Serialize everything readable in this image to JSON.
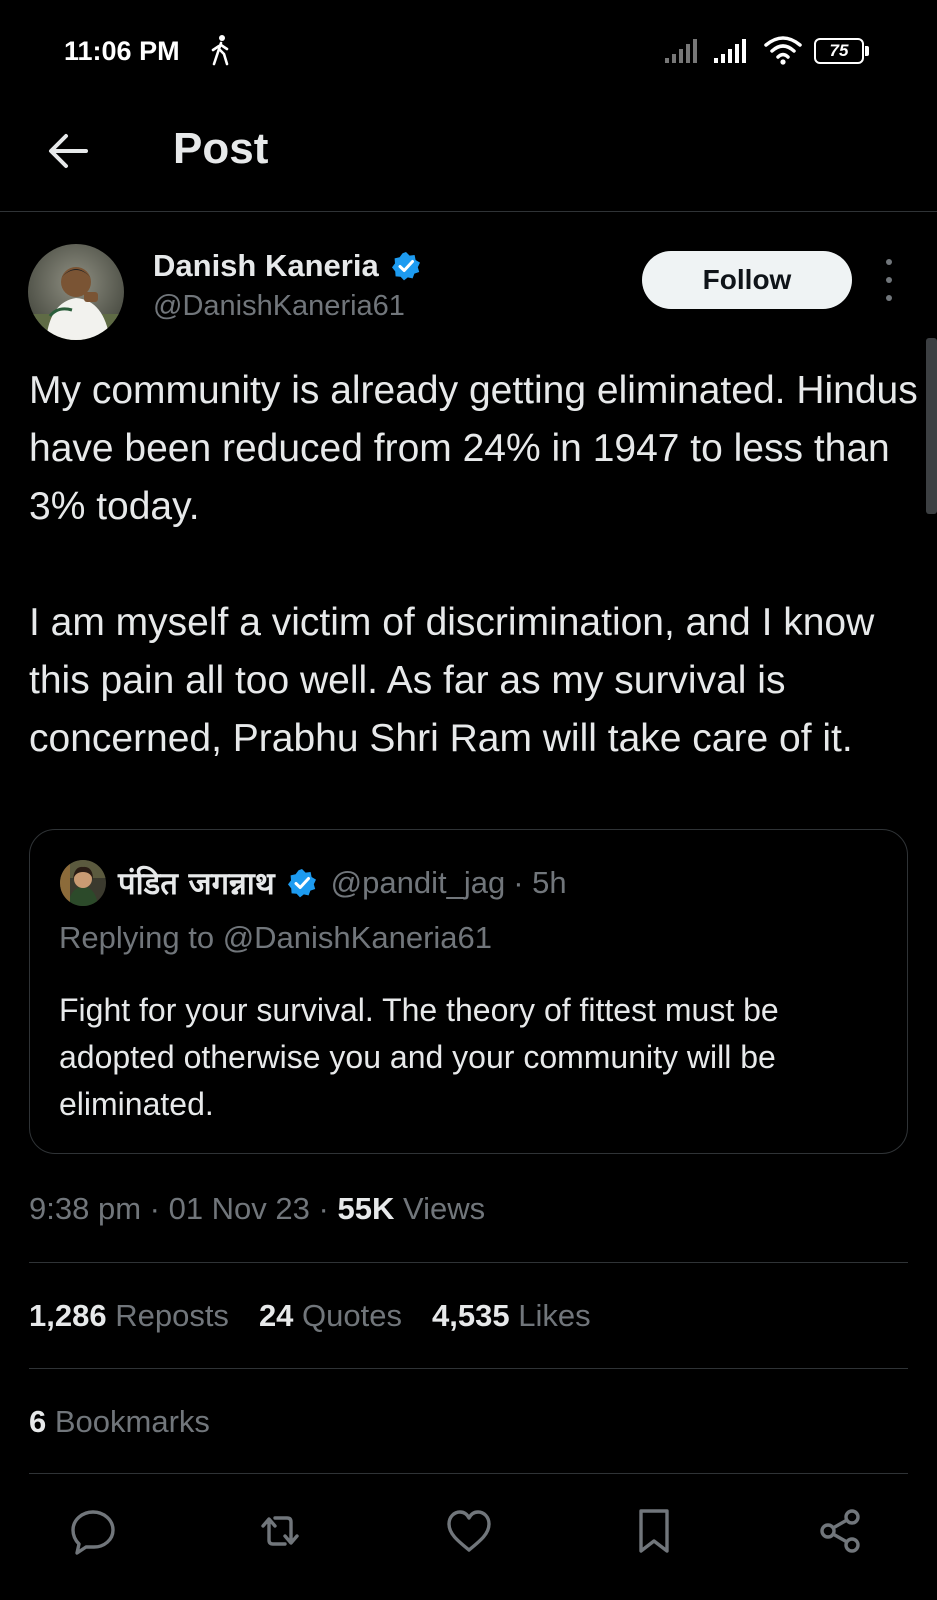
{
  "status_bar": {
    "time": "11:06 PM",
    "battery": "75",
    "icons": [
      "walking-icon",
      "signal-icon",
      "signal-icon",
      "wifi-icon",
      "battery-icon"
    ]
  },
  "header": {
    "title": "Post",
    "back_icon": "arrow-left-icon"
  },
  "author": {
    "name": "Danish Kaneria",
    "handle": "@DanishKaneria61",
    "verified": true,
    "follow_label": "Follow"
  },
  "post": {
    "paragraphs": [
      "My community is already getting eliminated. Hindus have been reduced from 24% in 1947 to less than 3% today.",
      "I am myself a victim of discrimination, and I know this pain all too well. As far as my survival is concerned, Prabhu Shri Ram will take care of it."
    ]
  },
  "quote": {
    "name": "पंडित जगन्नाथ",
    "handle": "@pandit_jag",
    "time": "· 5h",
    "replying": "Replying to @DanishKaneria61",
    "text": "Fight for your survival. The theory of fittest must be adopted otherwise you and your community will be eliminated."
  },
  "meta": {
    "time": "9:38 pm",
    "date": "01 Nov 23",
    "views_count": "55K",
    "views_label": "Views"
  },
  "stats": {
    "reposts_count": "1,286",
    "reposts_label": "Reposts",
    "quotes_count": "24",
    "quotes_label": "Quotes",
    "likes_count": "4,535",
    "likes_label": "Likes",
    "bookmarks_count": "6",
    "bookmarks_label": "Bookmarks"
  },
  "actions": [
    "reply-icon",
    "repost-icon",
    "like-icon",
    "bookmark-icon",
    "share-icon"
  ],
  "colors": {
    "background": "#000000",
    "text": "#e7e9ea",
    "muted": "#71767b",
    "verified": "#1d9bf0",
    "border": "#2f3336"
  }
}
